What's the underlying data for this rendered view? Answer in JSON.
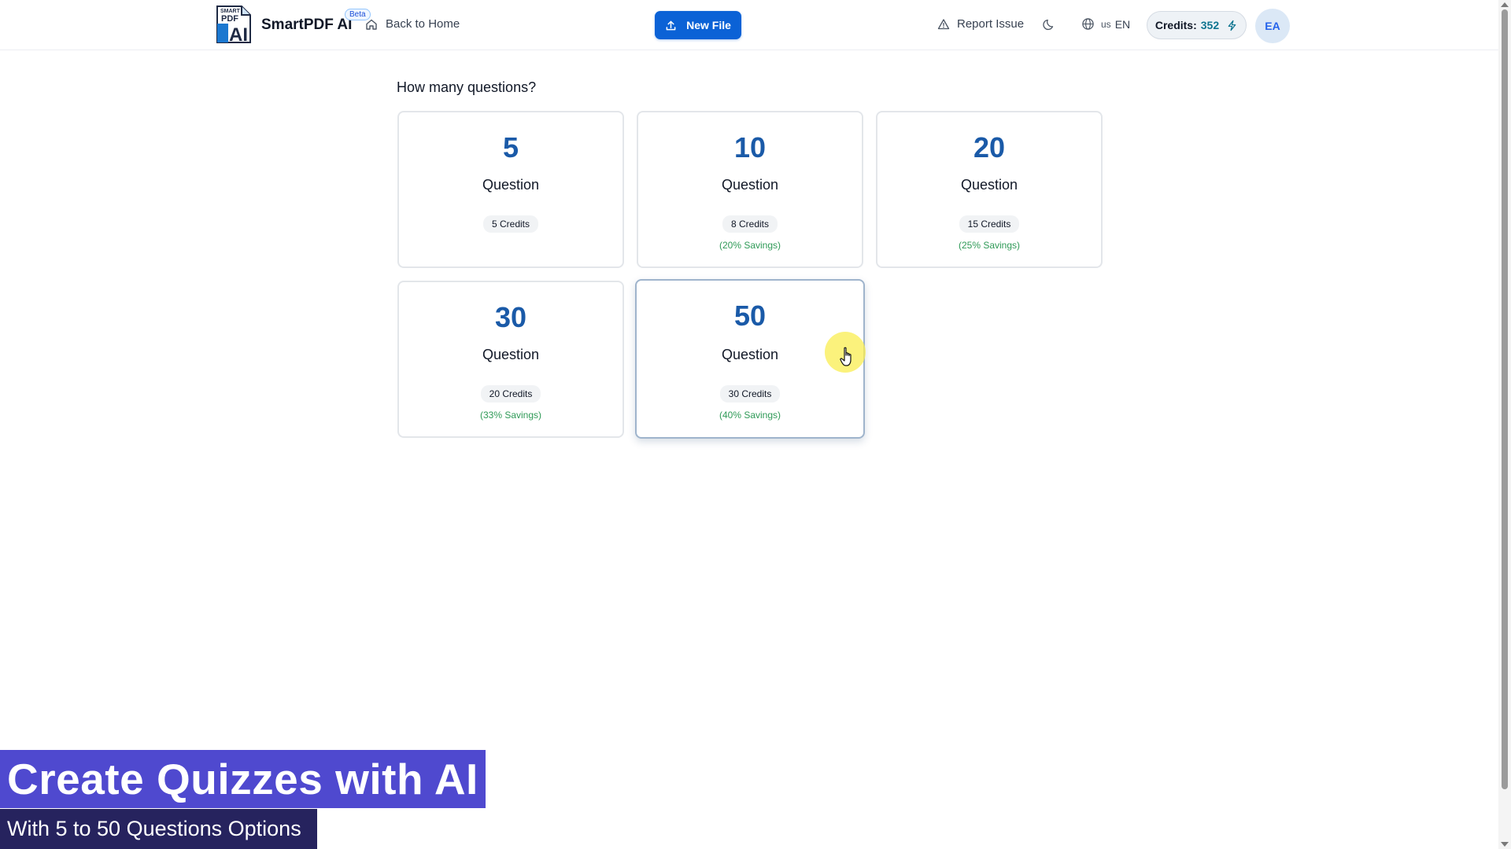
{
  "header": {
    "logo_text_top": "SMART",
    "logo_text_mid": "PDF",
    "logo_text_big": "AI",
    "brand": "SmartPDF AI",
    "beta": "Beta",
    "back_home": "Back to Home",
    "new_file": "New File",
    "report_issue": "Report Issue",
    "lang_flag": "us",
    "lang_code": "EN",
    "credits_label": "Credits:",
    "credits_value": "352",
    "avatar_initials": "EA"
  },
  "main": {
    "title": "How many questions?",
    "options": [
      {
        "count": "5",
        "label": "Question",
        "credits": "5 Credits",
        "savings": ""
      },
      {
        "count": "10",
        "label": "Question",
        "credits": "8 Credits",
        "savings": "(20% Savings)"
      },
      {
        "count": "20",
        "label": "Question",
        "credits": "15 Credits",
        "savings": "(25% Savings)"
      },
      {
        "count": "30",
        "label": "Question",
        "credits": "20 Credits",
        "savings": "(33% Savings)"
      },
      {
        "count": "50",
        "label": "Question",
        "credits": "30 Credits",
        "savings": "(40% Savings)"
      }
    ]
  },
  "captions": {
    "main": "Create Quizzes with AI",
    "sub": "With 5 to 50 Questions Options"
  },
  "colors": {
    "accent": "#0b62d6",
    "number": "#1a5aa8",
    "savings": "#2f9a57",
    "caption_main_bg": "#4f49cf",
    "caption_sub_bg": "#26235e"
  },
  "icons": {
    "back_home": "home-icon",
    "new_file": "upload-icon",
    "report_issue": "warning-triangle-icon",
    "theme": "moon-icon",
    "language": "globe-icon",
    "credits": "lightning-icon"
  }
}
